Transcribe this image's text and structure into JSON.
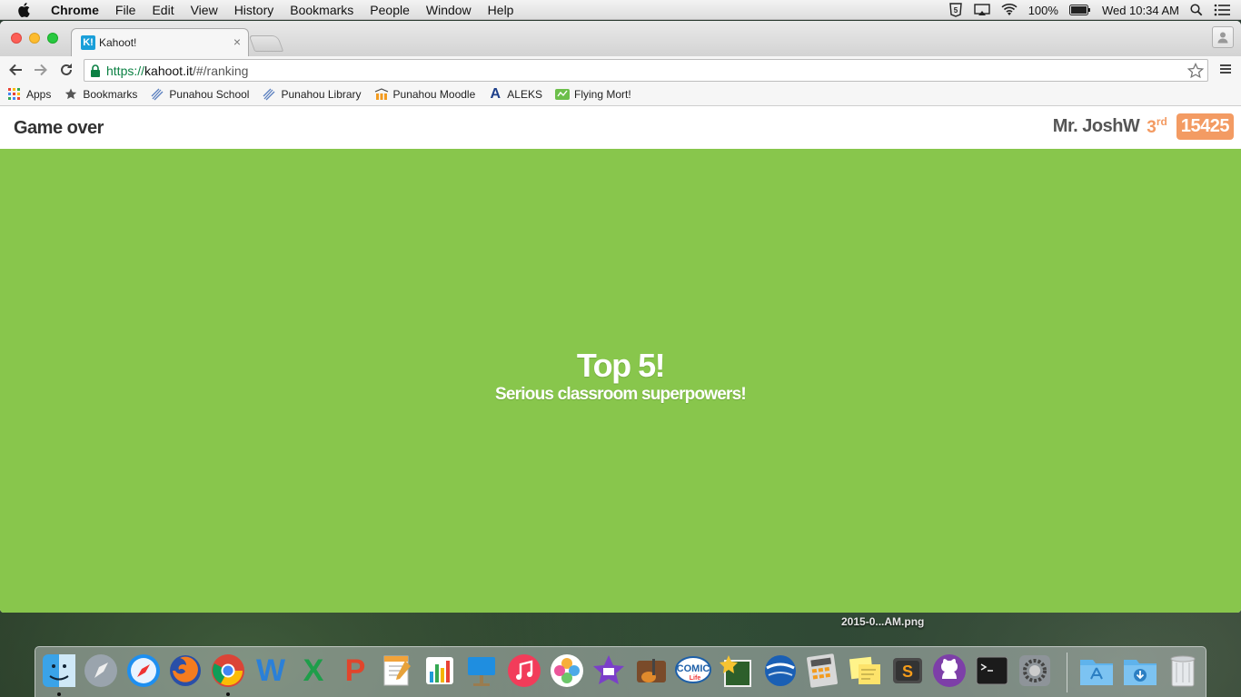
{
  "menubar": {
    "app_name": "Chrome",
    "menus": [
      "File",
      "Edit",
      "View",
      "History",
      "Bookmarks",
      "People",
      "Window",
      "Help"
    ],
    "battery": "100%",
    "clock": "Wed 10:34 AM"
  },
  "browser": {
    "tab_title": "Kahoot!",
    "tab_favicon": "K!",
    "url": {
      "scheme": "https://",
      "host": "kahoot.it",
      "path": "/#/ranking"
    },
    "bookmarks": [
      {
        "label": "Apps",
        "icon": "apps-grid-icon"
      },
      {
        "label": "Bookmarks",
        "icon": "star-icon"
      },
      {
        "label": "Punahou School",
        "icon": "bookmark-page-icon"
      },
      {
        "label": "Punahou Library",
        "icon": "bookmark-page-icon"
      },
      {
        "label": "Punahou Moodle",
        "icon": "moodle-icon"
      },
      {
        "label": "ALEKS",
        "icon": "aleks-icon"
      },
      {
        "label": "Flying Mort!",
        "icon": "flying-mort-icon"
      }
    ]
  },
  "kahoot": {
    "title": "Game over",
    "nickname": "Mr. JoshW",
    "rank_number": "3",
    "rank_suffix": "rd",
    "score": "15425",
    "headline": "Top 5!",
    "subtitle": "Serious classroom superpowers!",
    "colors": {
      "background": "#88c64c",
      "accent": "#f39b63"
    }
  },
  "desktop": {
    "file_label": "2015-0...AM.png"
  },
  "dock": {
    "apps": [
      "Finder",
      "Launchpad",
      "Safari",
      "Firefox",
      "Chrome",
      "Word",
      "Excel",
      "PowerPoint",
      "Pages",
      "Numbers",
      "Keynote",
      "iTunes",
      "Photos",
      "iMovie",
      "GarageBand",
      "Comic Life",
      "Pixelmator",
      "Google Earth",
      "Calculator",
      "Stickies",
      "Sublime Text",
      "GitHub",
      "Terminal",
      "System Preferences",
      "Applications",
      "Downloads",
      "Trash"
    ]
  }
}
